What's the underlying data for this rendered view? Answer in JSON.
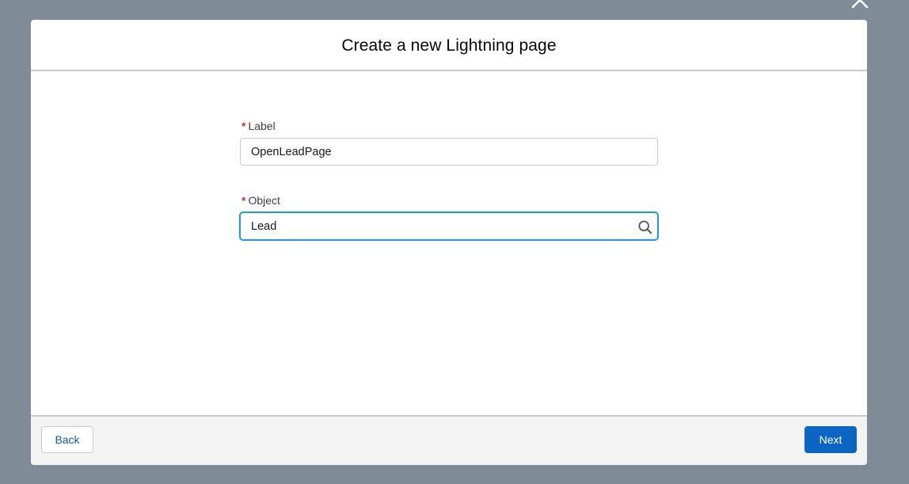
{
  "modal": {
    "title": "Create a new Lightning page"
  },
  "form": {
    "label_field": {
      "required_marker": "*",
      "label": "Label",
      "value": "OpenLeadPage"
    },
    "object_field": {
      "required_marker": "*",
      "label": "Object",
      "value": "Lead",
      "icon": "search-icon"
    }
  },
  "footer": {
    "back_label": "Back",
    "next_label": "Next"
  },
  "icons": {
    "close": "close-icon"
  },
  "colors": {
    "overlay": "#808b98",
    "primary": "#0b65c2",
    "focus_border": "#1b96ff",
    "required": "#c23934",
    "link_text": "#0b5cab"
  }
}
